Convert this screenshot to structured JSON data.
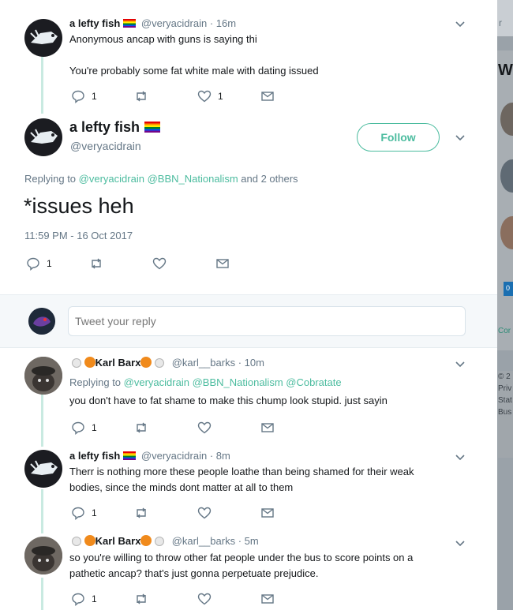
{
  "colors": {
    "accent": "#4cbc9f",
    "text": "#14171a",
    "muted": "#657786"
  },
  "tweets": [
    {
      "name": "a lefty fish",
      "handle": "@veryacidrain",
      "time": "16m",
      "text_lines": [
        "Anonymous ancap with guns is saying thi",
        "",
        "You're probably some fat white male with dating issued"
      ],
      "reply_count": "1",
      "like_count": "1"
    },
    {
      "name": "Karl Barx",
      "handle": "@karl__barks",
      "time": "10m",
      "replying_label": "Replying to",
      "replying_mentions": [
        "@veryacidrain",
        "@BBN_Nationalism",
        "@Cobratate"
      ],
      "text_lines": [
        "you don't have to fat shame to make this chump look stupid. just sayin"
      ],
      "reply_count": "1"
    },
    {
      "name": "a lefty fish",
      "handle": "@veryacidrain",
      "time": "8m",
      "text_lines": [
        "Therr is nothing more these people loathe than being shamed for their weak",
        "bodies, since the minds dont matter at all to them"
      ],
      "reply_count": "1"
    },
    {
      "name": "Karl Barx",
      "handle": "@karl__barks",
      "time": "5m",
      "text_lines": [
        "so you're willing to throw other fat people under the bus to score points on a",
        "pathetic ancap? that's just gonna perpetuate prejudice."
      ],
      "reply_count": "1"
    }
  ],
  "focused": {
    "name": "a lefty fish",
    "handle": "@veryacidrain",
    "follow_label": "Follow",
    "replying_label": "Replying to",
    "replying_mentions": [
      "@veryacidrain",
      "@BBN_Nationalism"
    ],
    "replying_others": "and 2 others",
    "text": "*issues heh",
    "timestamp": "11:59 PM - 16 Oct 2017",
    "reply_count": "1"
  },
  "reply_box": {
    "placeholder": "Tweet your reply"
  },
  "side": {
    "top_text": "r",
    "heading_letter": "W",
    "badge": "0",
    "link_text": "Cor",
    "footer_lines": [
      "© 2",
      "Priv",
      "Stat",
      "Bus"
    ]
  }
}
